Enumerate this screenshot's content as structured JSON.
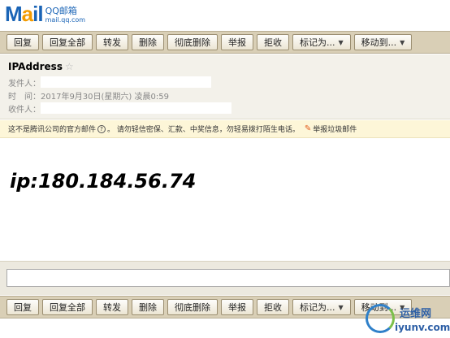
{
  "logo": {
    "brand_m": "M",
    "brand_a": "a",
    "brand_il": "il",
    "product": "QQ邮箱",
    "domain": "mail.qq.com"
  },
  "toolbar": {
    "reply": "回复",
    "reply_all": "回复全部",
    "forward": "转发",
    "delete": "删除",
    "delete_forever": "彻底删除",
    "report": "举报",
    "reject": "拒收",
    "mark_as": "标记为...",
    "move_to": "移动到..."
  },
  "message": {
    "subject": "IPAddress",
    "sender_label": "发件人：",
    "time_label": "时　间：",
    "time_value": "2017年9月30日(星期六) 凌晨0:59",
    "recipient_label": "收件人：",
    "body": "ip:180.184.56.74"
  },
  "notice": {
    "text": "这不是腾讯公司的官方邮件",
    "help": "?",
    "warning": "。 请勿轻信密保、汇款、中奖信息，勿轻易拨打陌生电话。",
    "report_link": "举报垃圾邮件"
  },
  "reply_box": {
    "placeholder": ""
  },
  "watermark": {
    "title": "运维网",
    "url": "iyunv.com"
  },
  "colors": {
    "toolbar": "#d9cfb6",
    "notice": "#fdf6d8",
    "meta": "#f3f1ea",
    "brand_blue": "#1a64b6",
    "brand_orange": "#f39b00"
  }
}
